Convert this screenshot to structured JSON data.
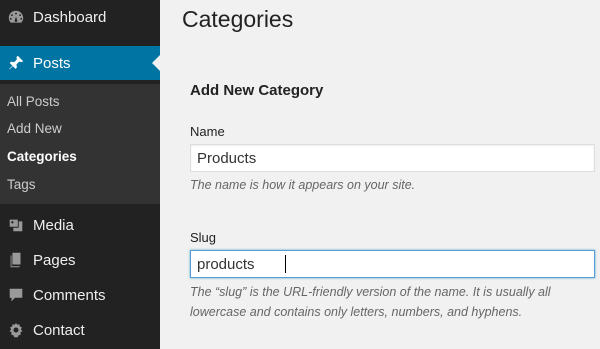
{
  "sidebar": {
    "menu": [
      {
        "label": "Dashboard",
        "icon": "dashboard-icon"
      },
      {
        "label": "Posts",
        "icon": "pin-icon",
        "active": true
      },
      {
        "label": "Media",
        "icon": "media-icon"
      },
      {
        "label": "Pages",
        "icon": "pages-icon"
      },
      {
        "label": "Comments",
        "icon": "comment-icon"
      },
      {
        "label": "Contact",
        "icon": "gear-icon"
      }
    ],
    "submenu": [
      {
        "label": "All Posts"
      },
      {
        "label": "Add New"
      },
      {
        "label": "Categories",
        "current": true
      },
      {
        "label": "Tags"
      }
    ]
  },
  "main": {
    "page_title": "Categories",
    "section_title": "Add New Category",
    "name_field": {
      "label": "Name",
      "value": "Products",
      "description": "The name is how it appears on your site."
    },
    "slug_field": {
      "label": "Slug",
      "value": "products",
      "description": "The “slug” is the URL-friendly version of the name. It is usually all lowercase and contains only letters, numbers, and hyphens."
    }
  },
  "colors": {
    "sidebar_bg": "#222222",
    "submenu_bg": "#333333",
    "active_bg": "#0074a2",
    "content_bg": "#f1f1f1"
  }
}
